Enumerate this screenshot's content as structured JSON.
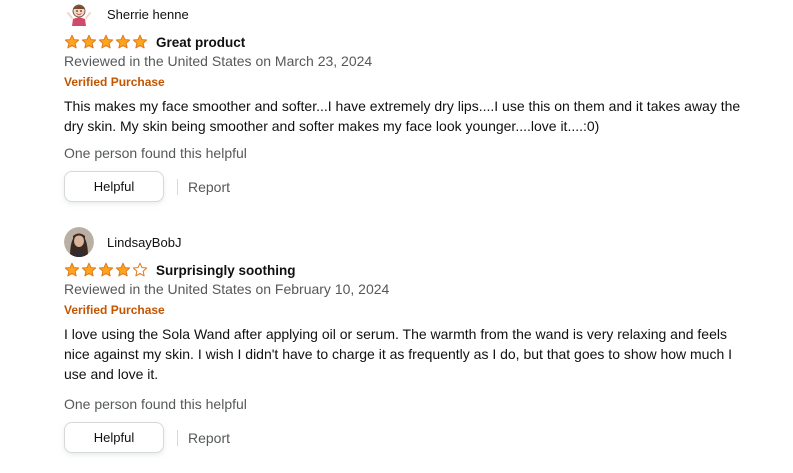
{
  "colors": {
    "star_fill": "#ffa41c",
    "star_outline": "#de7921",
    "verified": "#c45500",
    "muted_text": "#565959",
    "text": "#0f1111",
    "button_border": "#d5d9d9"
  },
  "reviews": [
    {
      "profile_name": "Sherrie henne",
      "avatar_icon": "cartoon-avatar-icon",
      "rating": 5,
      "title": "Great product",
      "meta": "Reviewed in the United States on March 23, 2024",
      "verified": "Verified Purchase",
      "body": "This makes my face smoother and softer...I have extremely dry lips....I use this on them and it takes away the dry skin. My skin being smoother and softer makes my face look younger....love it....:0)",
      "helpful_count": "One person found this helpful",
      "helpful_label": "Helpful",
      "report_label": "Report"
    },
    {
      "profile_name": "LindsayBobJ",
      "avatar_icon": "photo-avatar-icon",
      "rating": 4,
      "title": "Surprisingly soothing",
      "meta": "Reviewed in the United States on February 10, 2024",
      "verified": "Verified Purchase",
      "body": "I love using the Sola Wand after applying oil or serum. The warmth from the wand is very relaxing and feels nice against my skin. I wish I didn't have to charge it as frequently as I do, but that goes to show how much I use and love it.",
      "helpful_count": "One person found this helpful",
      "helpful_label": "Helpful",
      "report_label": "Report"
    }
  ]
}
